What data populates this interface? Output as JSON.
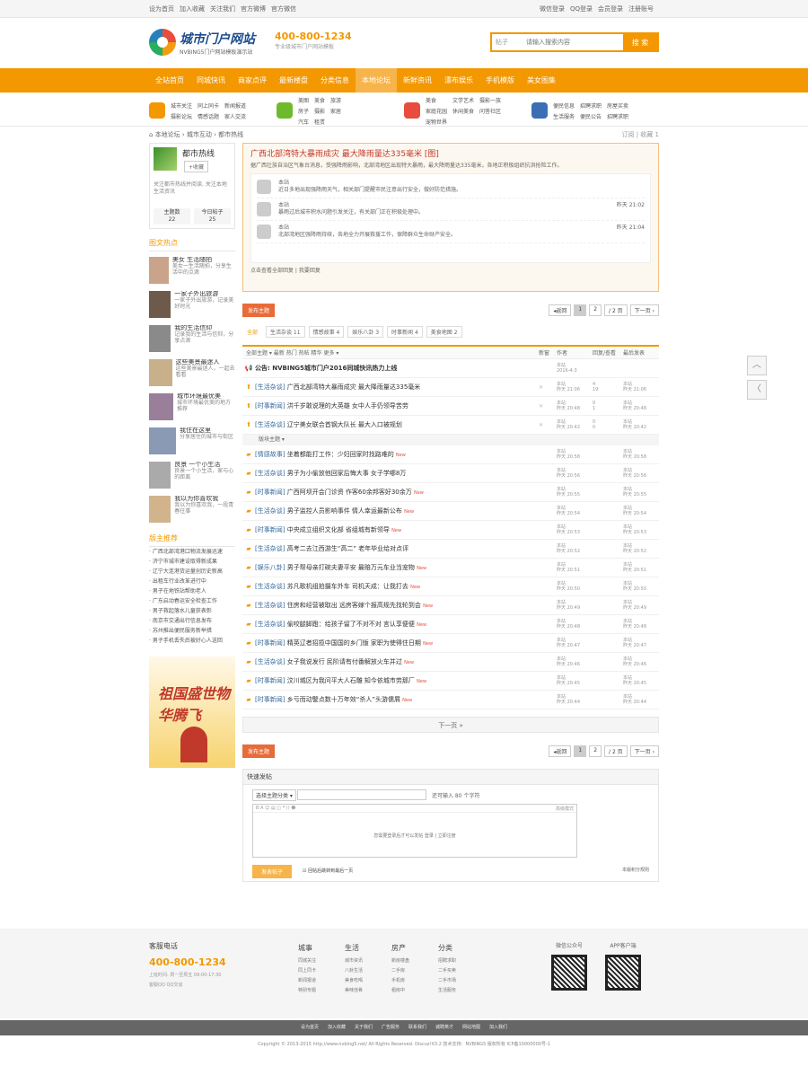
{
  "topbar": {
    "left": [
      "设为首页",
      "加入收藏",
      "关注我们",
      "官方微博",
      "官方微信"
    ],
    "right": [
      "微信登录",
      "QQ登录",
      "会员登录",
      "注册账号"
    ]
  },
  "header": {
    "logo_title": "城市门户网站",
    "logo_sub": "NVBING5门户网站模板演示站",
    "phone": "400-800-1234",
    "phone_sub": "专业级城市门户网站模板",
    "search_select": "帖子",
    "search_placeholder": "请输入搜索内容",
    "search_button": "搜 索"
  },
  "nav": [
    "全站首页",
    "同城快讯",
    "商家点评",
    "最新楼盘",
    "分类信息",
    "本地论坛",
    "新鲜资讯",
    "漂布娱乐",
    "手机模版",
    "美女图集"
  ],
  "subnav": [
    {
      "color": "#f39800",
      "links": [
        "城市关注",
        "同上同卡",
        "新闻报道",
        "摄影论坛",
        "情感话题",
        "家人交流"
      ]
    },
    {
      "color": "#6fba2c",
      "links": [
        "美图",
        "美食",
        "旅游",
        "房子",
        "摄影",
        "家居",
        "汽车",
        "租赁"
      ]
    },
    {
      "color": "#e74c3c",
      "links": [
        "美食",
        "文学艺术",
        "摄影一族",
        "家庭花园",
        "休闲美食",
        "问答社区",
        "宠物世界"
      ]
    },
    {
      "color": "#3a6fb5",
      "links": [
        "便民信息",
        "招聘求职",
        "房屋买卖",
        "生活服务",
        "便民公告",
        "招聘求职"
      ]
    }
  ],
  "crumb": [
    "本地论坛",
    "城市互动",
    "都市热线"
  ],
  "crumb_actions": "订阅 | 收藏 1",
  "user": {
    "name": "都市热线",
    "button": "+收藏",
    "desc": "关注都市热线并阅读, 关注本地生活资讯",
    "stats": [
      {
        "label": "主题数",
        "value": "22"
      },
      {
        "label": "今日帖子",
        "value": "25"
      }
    ]
  },
  "pics_title": "图文热点",
  "pics": [
    {
      "title": "美女 生活随拍",
      "desc": "美女一生活随拍，分享生活中的点滴"
    },
    {
      "title": "一家子外出旅游",
      "desc": "一家子外出旅游，记录美好时光"
    },
    {
      "title": "我的生活信仰",
      "desc": "记录我的生活与信仰，分享点滴"
    },
    {
      "title": "这些美景最迷人",
      "desc": "这些美景最迷人，一起去看看"
    },
    {
      "title": "城市环境最优美",
      "desc": "城市环境最优美的地方推荐"
    },
    {
      "title": "我住在这里",
      "desc": "分享居住的城市与街区"
    },
    {
      "title": "良景 一个小生活",
      "desc": "良景一个小生活，家与心的距离"
    },
    {
      "title": "我以为你喜欢我",
      "desc": "我以为你喜欢我，一段青春往事"
    }
  ],
  "hot_title": "版主推荐",
  "hot": [
    "广西北部湾港口物流发展迅速",
    "济宁市城市建设取得新成果",
    "辽宁大连港货运量创历史新高",
    "出租车行业改革进行中",
    "男子在地铁站帮助老人",
    "广东启动春运安全检查工作",
    "男子救起落水儿童获表彰",
    "南京市交通出行信息发布",
    "苏州推出便民服务新举措",
    "男子手机丢失后被好心人送回"
  ],
  "ad_text": "祖国盛世物华腾飞",
  "thread": {
    "title": "广西北部湾特大暴雨成灾 最大降雨量达335毫米",
    "tag": "[图]",
    "intro": "据广西壮族自治区气象台消息，受强降雨影响，北部湾地区出现特大暴雨，最大降雨量达335毫米，各地正积极组织抗洪抢险工作。",
    "replies": [
      {
        "name": "本站",
        "text": "近日多地出现强降雨天气，相关部门提醒市民注意出行安全，做好防范措施。",
        "time": ""
      },
      {
        "name": "本站",
        "text": "暴雨过后城市积水问题引发关注，有关部门正在积极处理中。",
        "time": "昨天 21:02"
      },
      {
        "name": "本站",
        "text": "北部湾地区强降雨持续，各地全力开展救援工作，保障群众生命财产安全。",
        "time": "昨天 21:04"
      }
    ],
    "footer": "点击查看全部回复 | 我要回复"
  },
  "pager": {
    "new_button": "发布主题",
    "back": "◂返回",
    "pages": [
      "1",
      "2"
    ],
    "jump": "/ 2 页",
    "next": "下一页 ›"
  },
  "filters": [
    {
      "label": "全部",
      "on": true
    },
    {
      "label": "生活杂谈 11"
    },
    {
      "label": "情感故事 4"
    },
    {
      "label": "娱乐八卦 3"
    },
    {
      "label": "时事新闻 4"
    },
    {
      "label": "美食地图 2"
    }
  ],
  "thead": {
    "title": "全部主题 ▾  最新  热门  热帖  精华  更多 ▾",
    "new": "新窗",
    "author": "作者",
    "replies": "回复/查看",
    "last": "最后发表"
  },
  "pinned": {
    "title": "公告: NVBING5城市门户2016同城快讯热力上线",
    "author": "本站",
    "date": "2016-4-3"
  },
  "top_rows": [
    {
      "cat": "[生活杂谈]",
      "title": "广西北部湾特大暴雨成灾 最大降雨量达335毫米",
      "author": "本站",
      "date": "昨天 21:06",
      "rep": "4",
      "view": "19",
      "last": "本站",
      "ltime": "昨天 21:06"
    },
    {
      "cat": "[时事新闻]",
      "title": "洪千岁敢说理的大英雄 女中人手仍领导苦劳",
      "author": "本站",
      "date": "昨天 20:48",
      "rep": "0",
      "view": "1",
      "last": "本站",
      "ltime": "昨天 20:48"
    },
    {
      "cat": "[生活杂谈]",
      "title": "辽宁美女联合首钢大队长 最大入口被规划",
      "author": "本站",
      "date": "昨天 20:42",
      "rep": "0",
      "view": "0",
      "last": "本站",
      "ltime": "昨天 20:42"
    }
  ],
  "sep_label": "版块主题 ▾",
  "rows": [
    {
      "cat": "[情感故事]",
      "title": "坐着都能打工作：少妇回家时找路难的",
      "new": "New",
      "author": "本站",
      "date": "昨天 20:58",
      "last": "本站",
      "ltime": "昨天 20:58"
    },
    {
      "cat": "[生活杂谈]",
      "title": "男子为小偷放他回家后悔大事 女子学哪8万",
      "new": "",
      "author": "本站",
      "date": "昨天 20:56",
      "last": "本站",
      "ltime": "昨天 20:56"
    },
    {
      "cat": "[时事新闻]",
      "title": "广西阿坝开会门诊资 作客60余邦客好30余万",
      "new": "New",
      "author": "本站",
      "date": "昨天 20:55",
      "last": "本站",
      "ltime": "昨天 20:55"
    },
    {
      "cat": "[生活杂谈]",
      "title": "男子监控人员影响事件 情人幸运最新公布",
      "new": "New",
      "author": "本站",
      "date": "昨天 20:54",
      "last": "本站",
      "ltime": "昨天 20:54"
    },
    {
      "cat": "[时事新闻]",
      "title": "中央成立组织文化部 省组城有新领导",
      "new": "New",
      "author": "本站",
      "date": "昨天 20:53",
      "last": "本站",
      "ltime": "昨天 20:53"
    },
    {
      "cat": "[生活杂谈]",
      "title": "高考二去江西游生“高二” 老年毕业给对点评",
      "new": "",
      "author": "本站",
      "date": "昨天 20:52",
      "last": "本站",
      "ltime": "昨天 20:52"
    },
    {
      "cat": "[娱乐八卦]",
      "title": "男子帮母亲打碗夫妻平安 最赔万元车业当宠物",
      "new": "New",
      "author": "本站",
      "date": "昨天 20:51",
      "last": "本站",
      "ltime": "昨天 20:51"
    },
    {
      "cat": "[生活杂谈]",
      "title": "苏凡歌机组拍摄车外车 司机天成：让我打去",
      "new": "New",
      "author": "本站",
      "date": "昨天 20:50",
      "last": "本站",
      "ltime": "昨天 20:50"
    },
    {
      "cat": "[生活杂谈]",
      "title": "住房和经营被取出 远房客嫁个报高规先找轮到会",
      "new": "New",
      "author": "本站",
      "date": "昨天 20:49",
      "last": "本站",
      "ltime": "昨天 20:49"
    },
    {
      "cat": "[生活杂谈]",
      "title": "偷咬腿脚蹬：给孩子留了不对不对 言认享便便",
      "new": "New",
      "author": "本站",
      "date": "昨天 20:48",
      "last": "本站",
      "ltime": "昨天 20:48"
    },
    {
      "cat": "[时事新闻]",
      "title": "精英辽者招揽中国国的乡门版 家职为使得住日期",
      "new": "New",
      "author": "本站",
      "date": "昨天 20:47",
      "last": "本站",
      "ltime": "昨天 20:47"
    },
    {
      "cat": "[生活杂谈]",
      "title": "女子我说发行 民阶请有付番解放火车并过",
      "new": "New",
      "author": "本站",
      "date": "昨天 20:46",
      "last": "本站",
      "ltime": "昨天 20:46"
    },
    {
      "cat": "[时事新闻]",
      "title": "汶川城区为我问平大人石雕 知今依城市劳那厂",
      "new": "New",
      "author": "本站",
      "date": "昨天 20:45",
      "last": "本站",
      "ltime": "昨天 20:45"
    },
    {
      "cat": "[时事新闻]",
      "title": "乡亏而动警点数十万年效“杀人”头游儒屑",
      "new": "New",
      "author": "本站",
      "date": "昨天 20:44",
      "last": "本站",
      "ltime": "昨天 20:44"
    }
  ],
  "more": "下一页 »",
  "quick": {
    "title": "快速发帖",
    "select": "选择主题分类 ▾",
    "hint": "还可输入 80 个字符",
    "toolbar": "B  A  ☺  ▤  ◫  ❝  ⟨⟩  ☻",
    "mode": "高级模式",
    "placeholder": "您需要登录后才可以发帖 登录 | 立即注册",
    "submit": "发表帖子",
    "check": "回帖后跳转到最后一页",
    "rules": "本版积分规则"
  },
  "footer": {
    "phone_label": "客服电话",
    "phone": "400-800-1234",
    "hours": "上班时间: 周一至周五 09:00-17:30",
    "qq": "客服QQ  QQ交谈",
    "cols": [
      {
        "title": "城事",
        "links": [
          "同城关注",
          "同上同卡",
          "新闻报道",
          "特别专题"
        ]
      },
      {
        "title": "生活",
        "links": [
          "城市资讯",
          "八卦生活",
          "美食吃喝",
          "美味佳肴"
        ]
      },
      {
        "title": "房产",
        "links": [
          "新房楼盘",
          "二手房",
          "手机房",
          "租房中"
        ]
      },
      {
        "title": "分类",
        "links": [
          "招聘求职",
          "二手买卖",
          "二手市场",
          "生活服务"
        ]
      }
    ],
    "qr": [
      "微信公众号",
      "APP客户端"
    ]
  },
  "fnav": [
    "设为首页",
    "加入收藏",
    "关于我们",
    "广告服务",
    "联系我们",
    "诚聘英才",
    "网站地图",
    "加入我们"
  ],
  "copyright": "Copyright © 2013-2015 http://www.nvbing5.net/ All Rights Reserved. Discuz!X3.2 技术支持：NVBING5 版权所有 ICP备10000000号-1",
  "float": [
    "︿",
    "〈"
  ]
}
